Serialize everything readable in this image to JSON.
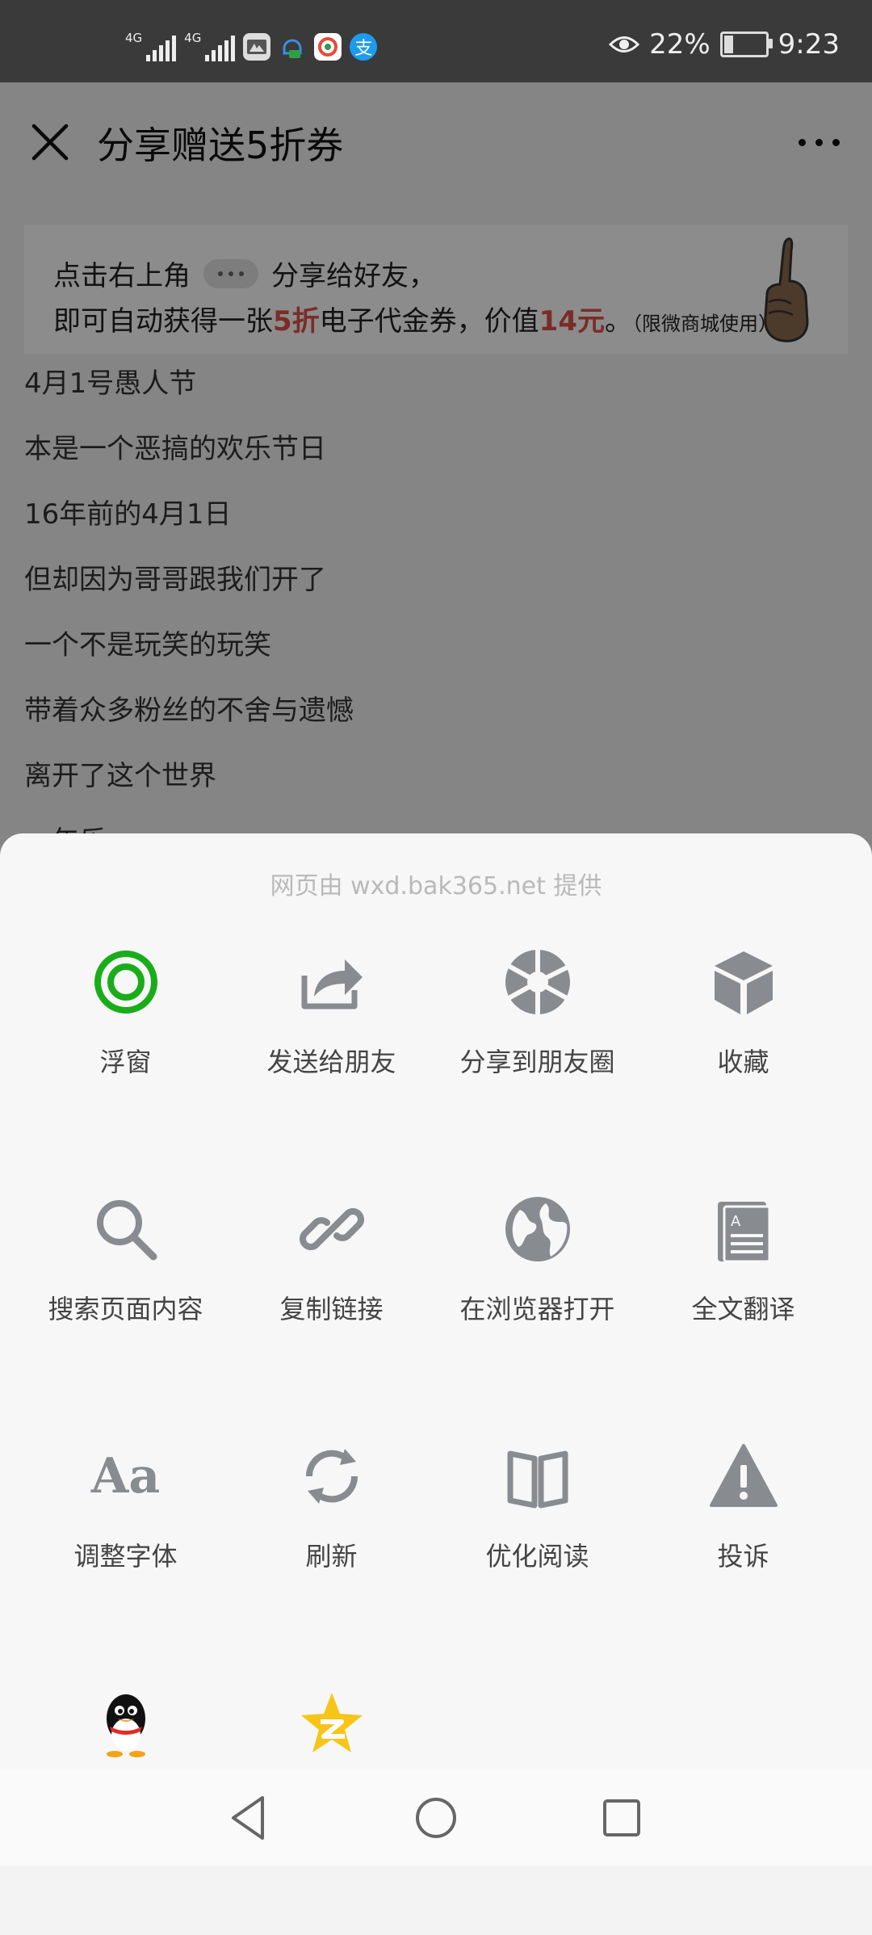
{
  "status_bar": {
    "net1": "4G",
    "net2": "4G",
    "battery_percent": "22%",
    "battery_level": 0.22,
    "time": "9:23",
    "alipay_glyph": "支",
    "icons": [
      "signal-icon",
      "signal-icon",
      "huawei-icon",
      "notification-icon",
      "weibo-icon",
      "alipay-icon",
      "eye-icon",
      "battery-icon"
    ]
  },
  "header": {
    "title": "分享赠送5折券"
  },
  "banner": {
    "line1_a": "点击右上角",
    "line1_b": "分享给好友，",
    "line2_a": "即可自动获得一张",
    "line2_red1": "5折",
    "line2_b": "电子代金券，价值",
    "line2_red2": "14元",
    "line2_c": "。",
    "line2_note": "（限微商城使用）"
  },
  "article": {
    "lines": [
      "4月1号愚人节",
      "本是一个恶搞的欢乐节日",
      "16年前的4月1日",
      "但却因为哥哥跟我们开了",
      "一个不是玩笑的玩笑",
      "带着众多粉丝的不舍与遗憾",
      "离开了这个世界",
      "一年乐"
    ]
  },
  "sheet": {
    "provider": "网页由 wxd.bak365.net 提供",
    "rows": [
      [
        {
          "label": "浮窗",
          "icon": "float-window-icon"
        },
        {
          "label": "发送给朋友",
          "icon": "send-to-friend-icon"
        },
        {
          "label": "分享到朋友圈",
          "icon": "moments-icon"
        },
        {
          "label": "收藏",
          "icon": "favorite-icon"
        }
      ],
      [
        {
          "label": "搜索页面内容",
          "icon": "search-icon"
        },
        {
          "label": "复制链接",
          "icon": "link-icon"
        },
        {
          "label": "在浏览器打开",
          "icon": "browser-icon"
        },
        {
          "label": "全文翻译",
          "icon": "translate-icon"
        }
      ],
      [
        {
          "label": "调整字体",
          "icon": "font-icon",
          "glyph": "Aa"
        },
        {
          "label": "刷新",
          "icon": "refresh-icon"
        },
        {
          "label": "优化阅读",
          "icon": "read-mode-icon"
        },
        {
          "label": "投诉",
          "icon": "complaint-icon"
        }
      ],
      [
        {
          "label": "",
          "icon": "qq-icon"
        },
        {
          "label": "",
          "icon": "qzone-icon"
        }
      ]
    ]
  },
  "colors": {
    "status_bar": "#3a3a3a",
    "accent_green": "#1aad19",
    "icon_gray": "#888b90",
    "banner_red": "#e0514a",
    "qzone_yellow": "#f6c518"
  },
  "nav": {
    "icons": [
      "back-icon",
      "home-icon",
      "recents-icon"
    ]
  }
}
